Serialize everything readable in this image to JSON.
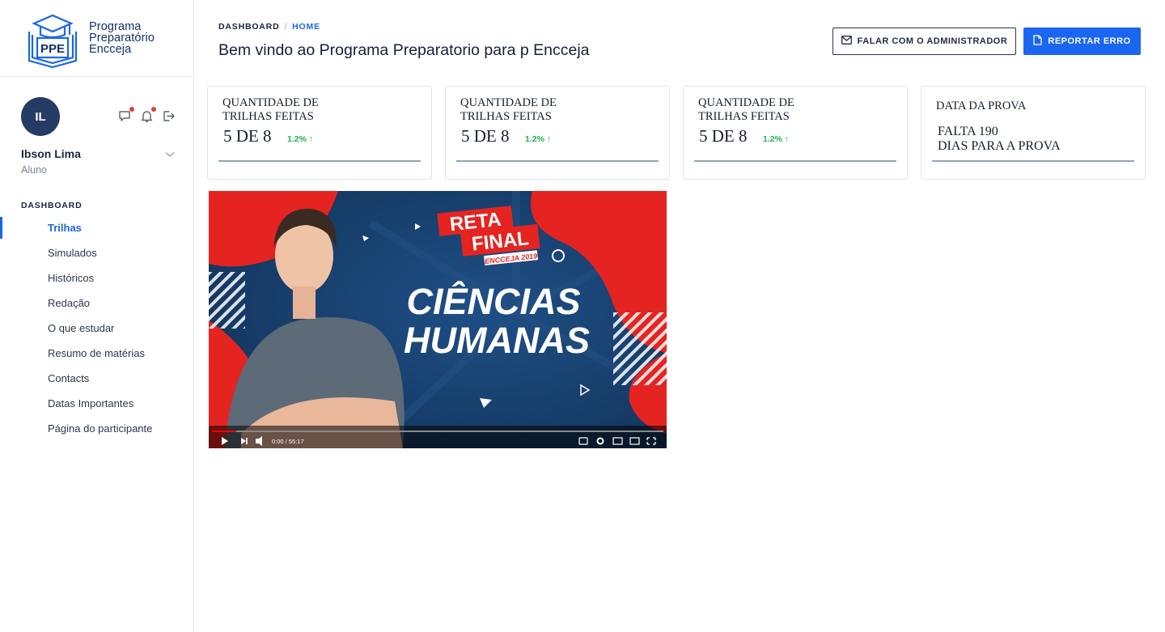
{
  "logo": {
    "badge": "PPE",
    "line1": "Programa",
    "line2": "Preparatório",
    "line3": "Encceja"
  },
  "user": {
    "initials": "IL",
    "name": "Ibson Lima",
    "role": "Aluno"
  },
  "nav": {
    "title": "DASHBOARD",
    "items": [
      {
        "label": "Trilhas"
      },
      {
        "label": "Simulados"
      },
      {
        "label": "Históricos"
      },
      {
        "label": "Redação"
      },
      {
        "label": "O que estudar"
      },
      {
        "label": "Resumo de matérias"
      },
      {
        "label": "Contacts"
      },
      {
        "label": "Datas Importantes"
      },
      {
        "label": "Página do participante"
      }
    ]
  },
  "breadcrumb": {
    "root": "DASHBOARD",
    "sep": "/",
    "current": "HOME"
  },
  "page_title": "Bem vindo ao Programa Preparatorio para p Encceja",
  "buttons": {
    "contact_admin": "FALAR COM O ADMINISTRADOR",
    "report_error": "REPORTAR ERRO"
  },
  "cards": [
    {
      "label_line1": "QUANTIDADE DE",
      "label_line2": "TRILHAS FEITAS",
      "value": "5 DE 8",
      "delta": "1.2% ↑"
    },
    {
      "label_line1": "QUANTIDADE DE",
      "label_line2": "TRILHAS FEITAS",
      "value": "5 DE 8",
      "delta": "1.2% ↑"
    },
    {
      "label_line1": "QUANTIDADE DE",
      "label_line2": "TRILHAS FEITAS",
      "value": "5 DE 8",
      "delta": "1.2% ↑"
    },
    {
      "label_line1": "DATA DA PROVA",
      "info_line1": "FALTA 190",
      "info_line2": "DIAS PARA A PROVA"
    }
  ],
  "video": {
    "banner_top": "RETA",
    "banner_bottom": "FINAL",
    "banner_sub": "ENCCEJA 2019",
    "headline1": "CIÊNCIAS",
    "headline2": "HUMANAS",
    "time": "0:00 / 55:17"
  },
  "colors": {
    "primary": "#1a66f0",
    "navy": "#263b63",
    "positive": "#22b14c",
    "video_red": "#e52421",
    "video_blue": "#163a63"
  }
}
